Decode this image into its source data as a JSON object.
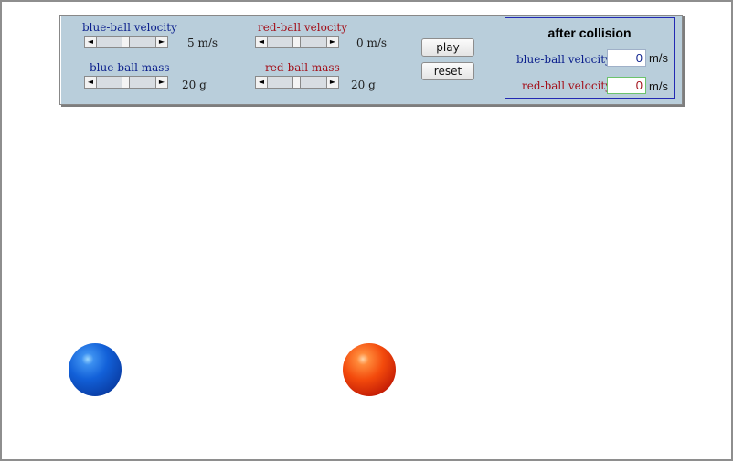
{
  "controls": {
    "blue_velocity": {
      "label": "blue-ball velocity",
      "value": "5",
      "unit": "m/s",
      "level": 0.5
    },
    "red_velocity": {
      "label": "red-ball velocity",
      "value": "0",
      "unit": "m/s",
      "level": 0.5
    },
    "blue_mass": {
      "label": "blue-ball mass",
      "value": "20",
      "unit": "g",
      "level": 0.5
    },
    "red_mass": {
      "label": "red-ball mass",
      "value": "20",
      "unit": "g",
      "level": 0.5
    },
    "left_arrow": "◄",
    "right_arrow": "►"
  },
  "buttons": {
    "play": "play",
    "reset": "reset"
  },
  "after_collision": {
    "title": "after collision",
    "blue_label": "blue-ball velocity",
    "blue_value": "0",
    "red_label": "red-ball velocity",
    "red_value": "0",
    "unit": "m/s"
  },
  "colors": {
    "blue_text": "#0b1f8c",
    "red_text": "#a3101a",
    "panel": "#b9cedb",
    "result_border": "#2229b3"
  }
}
